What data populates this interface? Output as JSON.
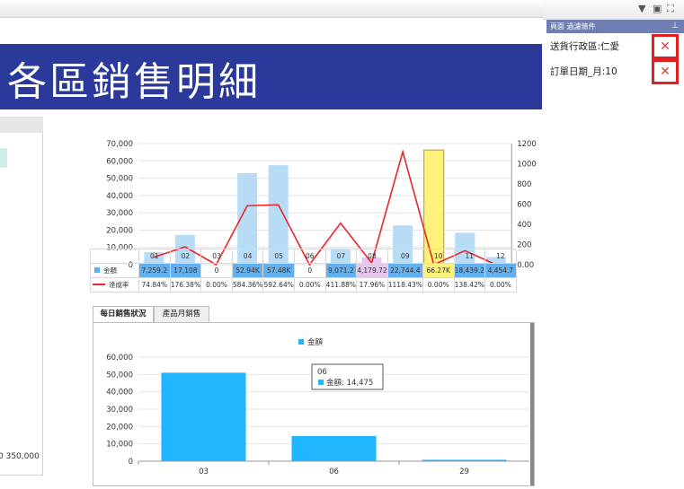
{
  "title": "各區銷售明細",
  "filter_panel": {
    "header": "頁面 過濾條件",
    "items": [
      {
        "label": "送貨行政區:仁愛"
      },
      {
        "label": "訂單日期_月:10"
      }
    ],
    "remove_glyph": "✕"
  },
  "left_chart": {
    "x_tick": "0 350,000"
  },
  "chart_data": [
    {
      "type": "bar",
      "categories": [
        "01",
        "02",
        "03",
        "04",
        "05",
        "06",
        "07",
        "08",
        "09",
        "10",
        "11",
        "12"
      ],
      "series": [
        {
          "name": "金額",
          "values": [
            7259.2,
            17108,
            0,
            52940,
            57480,
            0,
            9071.2,
            4179.72,
            22744.4,
            66270,
            18439.2,
            4454.7
          ],
          "color": "#b9dcf6"
        },
        {
          "name": "達成率",
          "values": [
            74.84,
            176.38,
            0,
            584.36,
            592.64,
            0,
            411.88,
            17.96,
            1118.43,
            0,
            138.42,
            0
          ],
          "color": "#e8262a"
        }
      ],
      "ylim": [
        0,
        70000
      ],
      "y_ticks": [
        "70,000",
        "60,000",
        "50,000",
        "40,000",
        "30,000",
        "20,000",
        "10,000",
        "0"
      ],
      "y2lim": [
        0,
        1200
      ],
      "y2_ticks": [
        "1200",
        "1000",
        "800",
        "600",
        "400",
        "200",
        "0.00"
      ],
      "table_amount": [
        "7,259.2",
        "17,108",
        "0",
        "52.94K",
        "57.48K",
        "0",
        "9,071.2",
        "4,179.72",
        "22,744.4",
        "66.27K",
        "18,439.2",
        "4,454.7"
      ],
      "table_rate": [
        "74.84%",
        "176.38%",
        "0.00%",
        "584.36%",
        "592.64%",
        "0.00%",
        "411.88%",
        "17.96%",
        "1118.43%",
        "0.00%",
        "138.42%",
        "0.00%"
      ]
    },
    {
      "type": "bar",
      "categories": [
        "03",
        "06",
        "29"
      ],
      "series": [
        {
          "name": "金額",
          "values": [
            51000,
            14475,
            800
          ],
          "color": "#1fb5ff"
        }
      ],
      "ylim": [
        0,
        60000
      ],
      "y_ticks": [
        "60,000",
        "50,000",
        "40,000",
        "30,000",
        "20,000",
        "10,000",
        "0"
      ],
      "tooltip": {
        "title": "06",
        "text": "金額: 14,475"
      }
    }
  ],
  "tabs": [
    {
      "label": "每日銷售狀況"
    },
    {
      "label": "產品月銷售"
    }
  ],
  "colors": {
    "banner": "#2b3a9a",
    "highlight_bar": "#fff27a",
    "highlight_cell_blue": "#64b0ef",
    "highlight_cell_purple": "#e7c6ee",
    "highlight_cell_yellow": "#fff27a",
    "remove_border": "#e02020"
  }
}
